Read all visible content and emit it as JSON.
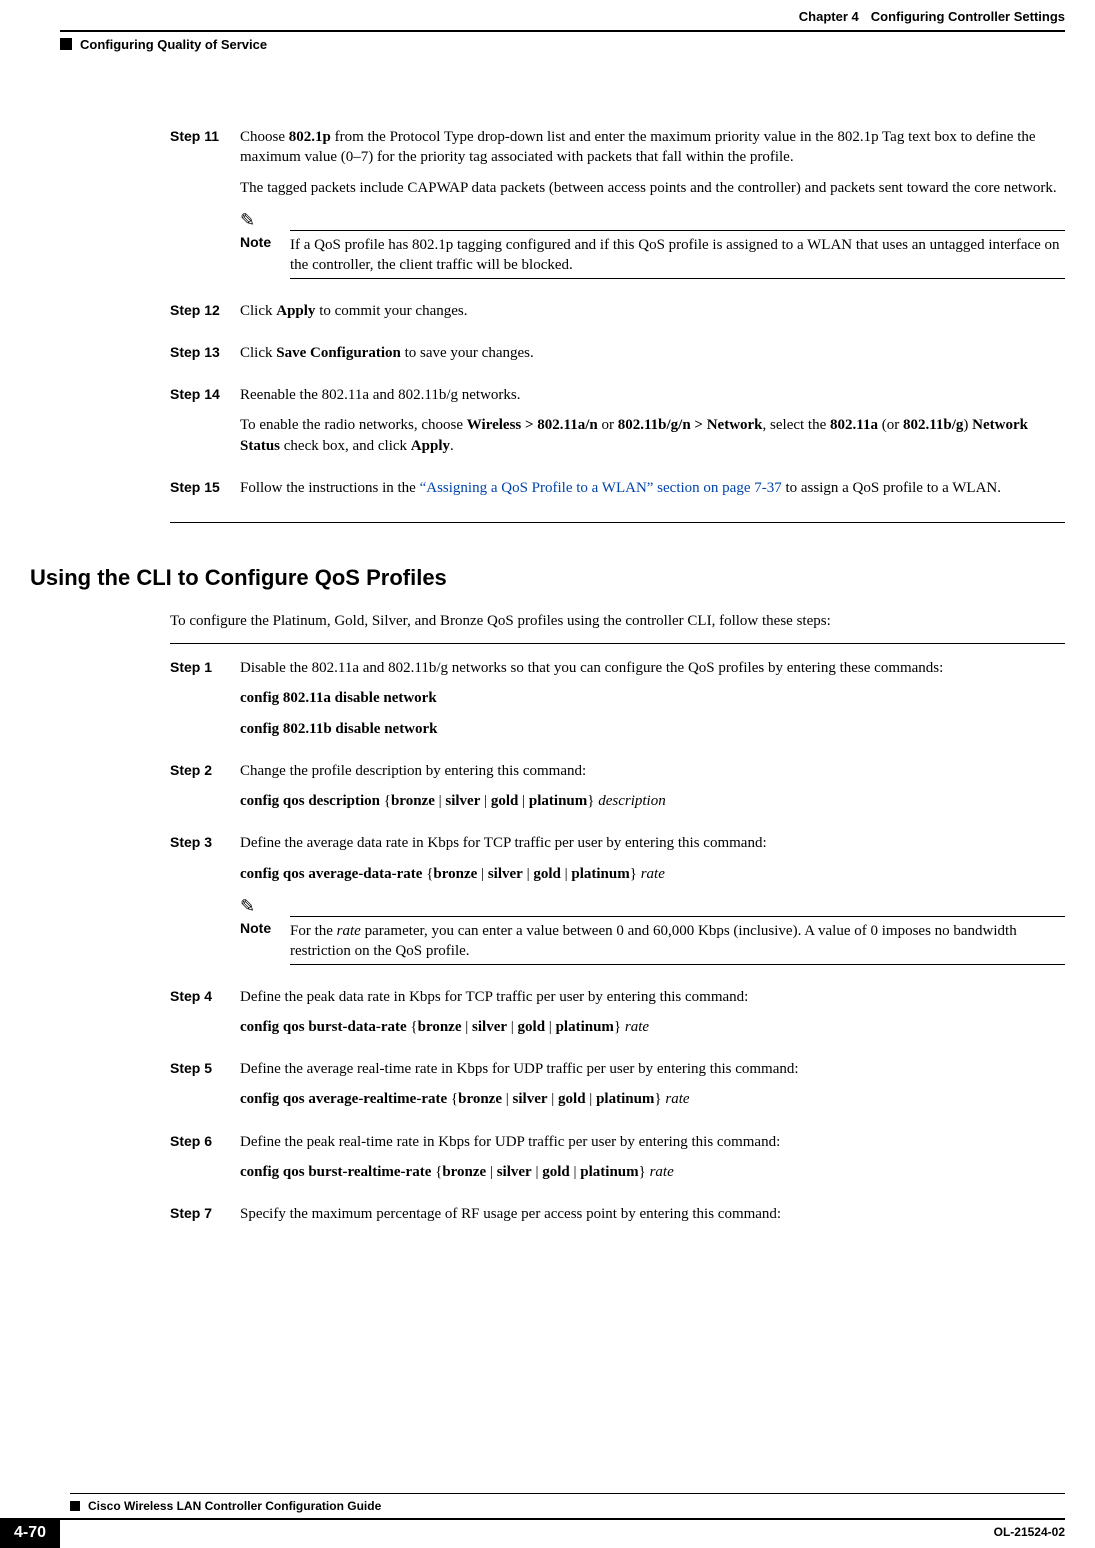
{
  "header": {
    "chapter_label": "Chapter 4",
    "chapter_title": "Configuring Controller Settings",
    "section_path": "Configuring Quality of Service"
  },
  "steps_a": [
    {
      "label": "Step 11",
      "paragraphs": [
        "Choose <b>802.1p</b> from the Protocol Type drop-down list and enter the maximum priority value in the 802.1p Tag text box to define the maximum value (0–7) for the priority tag associated with packets that fall within the profile.",
        "The tagged packets include CAPWAP data packets (between access points and the controller) and packets sent toward the core network."
      ],
      "note": "If a QoS profile has 802.1p tagging configured and if this QoS profile is assigned to a WLAN that uses an untagged interface on the controller, the client traffic will be blocked."
    },
    {
      "label": "Step 12",
      "paragraphs": [
        "Click <b>Apply</b> to commit your changes."
      ]
    },
    {
      "label": "Step 13",
      "paragraphs": [
        "Click <b>Save Configuration</b> to save your changes."
      ]
    },
    {
      "label": "Step 14",
      "paragraphs": [
        "Reenable the 802.11a and 802.11b/g networks.",
        "To enable the radio networks, choose <b>Wireless &gt; 802.11a/n</b> or <b>802.11b/g/n &gt; Network</b>, select the <b>802.11a</b> (or <b>802.11b/g</b>) <b>Network Status</b> check box, and click <b>Apply</b>."
      ]
    },
    {
      "label": "Step 15",
      "paragraphs": [
        "Follow the instructions in the <span class='link'>“Assigning a QoS Profile to a WLAN” section on page 7-37</span> to assign a QoS profile to a WLAN."
      ]
    }
  ],
  "section_b": {
    "title": "Using the CLI to Configure QoS Profiles",
    "intro": "To configure the Platinum, Gold, Silver, and Bronze QoS profiles using the controller CLI, follow these steps:"
  },
  "steps_b": [
    {
      "label": "Step 1",
      "paragraphs": [
        "Disable the 802.11a and 802.11b/g networks so that you can configure the QoS profiles by entering these commands:",
        "<b>config 802.11a disable network</b>",
        "<b>config 802.11b disable network</b>"
      ]
    },
    {
      "label": "Step 2",
      "paragraphs": [
        "Change the profile description by entering this command:",
        "<b>config qos description</b> {<b>bronze</b> | <b>silver</b> | <b>gold</b> | <b>platinum</b>} <i>description</i>"
      ]
    },
    {
      "label": "Step 3",
      "paragraphs": [
        "Define the average data rate in Kbps for TCP traffic per user by entering this command:",
        "<b>config qos average-data-rate</b> {<b>bronze</b> | <b>silver</b> | <b>gold</b> | <b>platinum</b>} <i>rate</i>"
      ],
      "note": "For the <i>rate</i> parameter, you can enter a value between 0 and 60,000 Kbps (inclusive). A value of 0 imposes no bandwidth restriction on the QoS profile."
    },
    {
      "label": "Step 4",
      "paragraphs": [
        "Define the peak data rate in Kbps for TCP traffic per user by entering this command:",
        "<b>config qos burst-data-rate</b> {<b>bronze</b> | <b>silver</b> | <b>gold</b> | <b>platinum</b>} <i>rate</i>"
      ]
    },
    {
      "label": "Step 5",
      "paragraphs": [
        "Define the average real-time rate in Kbps for UDP traffic per user by entering this command:",
        "<b>config qos average-realtime-rate</b> {<b>bronze</b> | <b>silver</b> | <b>gold</b> | <b>platinum</b>} <i>rate</i>"
      ]
    },
    {
      "label": "Step 6",
      "paragraphs": [
        "Define the peak real-time rate in Kbps for UDP traffic per user by entering this command:",
        "<b>config qos burst-realtime-rate</b> {<b>bronze</b> | <b>silver</b> | <b>gold</b> | <b>platinum</b>} <i>rate</i>"
      ]
    },
    {
      "label": "Step 7",
      "paragraphs": [
        "Specify the maximum percentage of RF usage per access point by entering this command:"
      ]
    }
  ],
  "note_label": "Note",
  "footer": {
    "book_title": "Cisco Wireless LAN Controller Configuration Guide",
    "page_number": "4-70",
    "doc_id": "OL-21524-02"
  }
}
